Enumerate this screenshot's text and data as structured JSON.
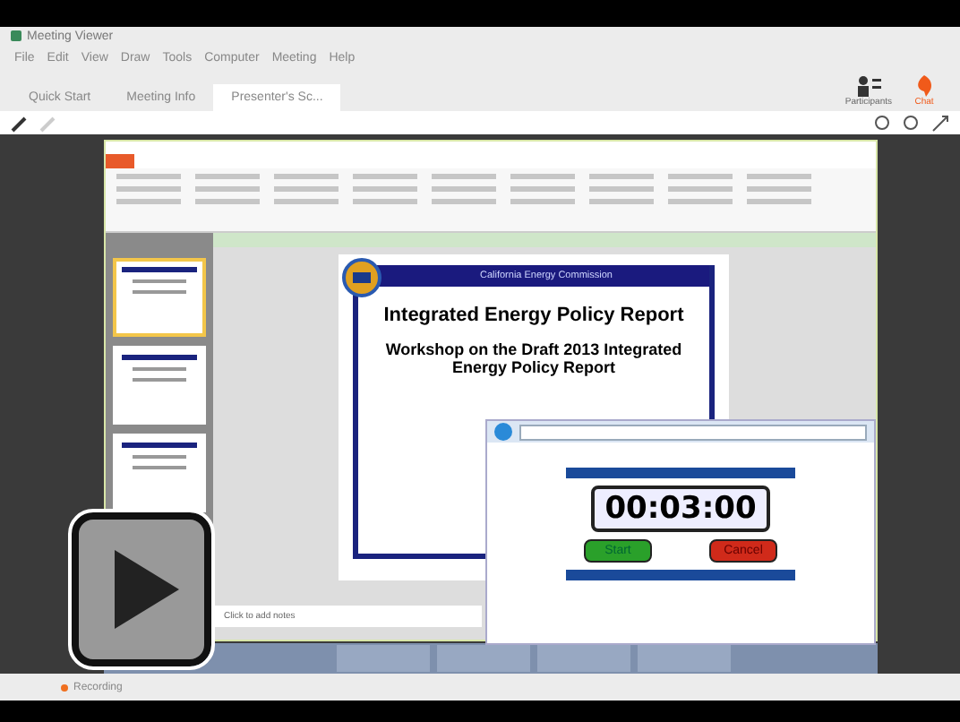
{
  "window": {
    "title": "Meeting Viewer"
  },
  "menu": [
    "File",
    "Edit",
    "View",
    "Draw",
    "Tools",
    "Computer",
    "Meeting",
    "Help"
  ],
  "tabs": [
    {
      "label": "Quick Start",
      "selected": false
    },
    {
      "label": "Meeting Info",
      "selected": false
    },
    {
      "label": "Presenter's Sc...",
      "selected": true
    }
  ],
  "toolbar_buttons": [
    {
      "label": "Participants",
      "kind": "participants"
    },
    {
      "label": "Chat",
      "kind": "chat"
    }
  ],
  "presentation": {
    "thumbnails": [
      {
        "selected": true
      },
      {
        "selected": false
      },
      {
        "selected": false
      }
    ],
    "slide": {
      "header": "California Energy Commission",
      "title": "Integrated Energy Policy Report",
      "subtitle": "Workshop on the Draft 2013 Integrated Energy Policy Report"
    },
    "notes_placeholder": "Click to add notes"
  },
  "timer_window": {
    "timer": "00:03:00",
    "buttons": [
      {
        "label": "Start",
        "kind": "start"
      },
      {
        "label": "Cancel",
        "kind": "cancel"
      }
    ]
  },
  "status_bar": {
    "recording": "Recording"
  }
}
